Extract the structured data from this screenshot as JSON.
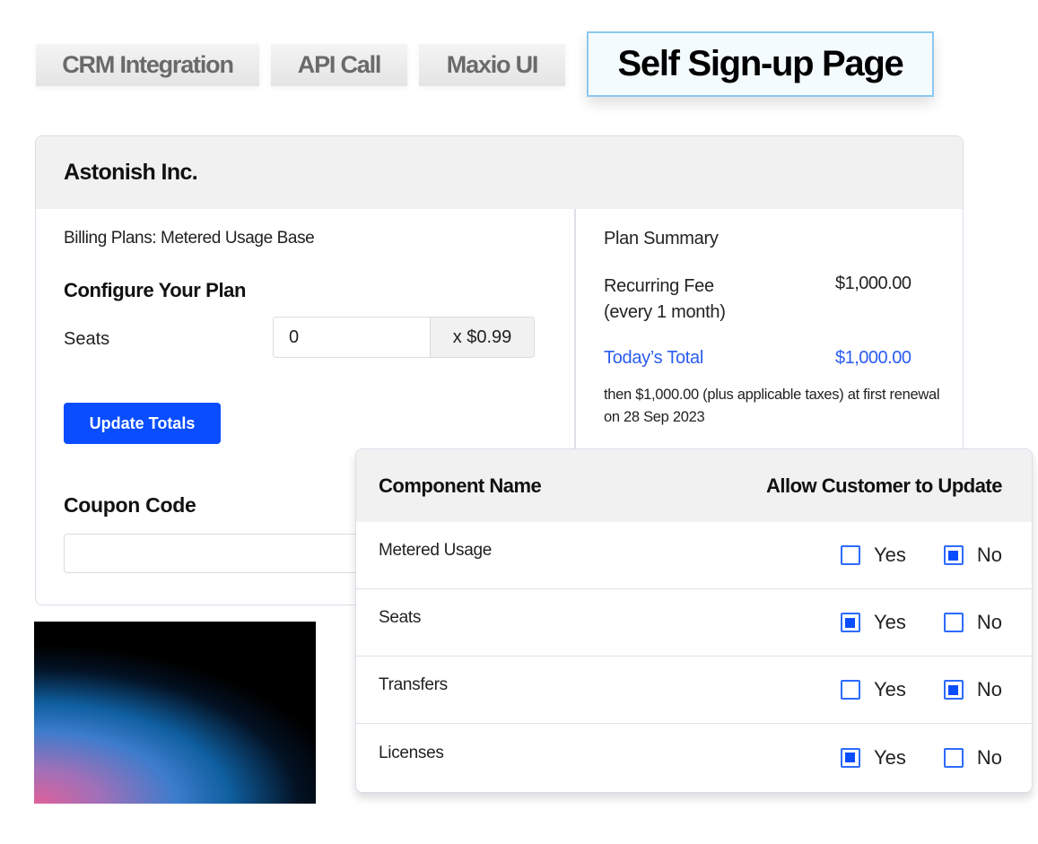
{
  "tabs": [
    {
      "label": "CRM Integration",
      "active": false
    },
    {
      "label": "API Call",
      "active": false
    },
    {
      "label": "Maxio UI",
      "active": false
    },
    {
      "label": "Self Sign-up Page",
      "active": true
    }
  ],
  "card": {
    "company": "Astonish Inc.",
    "billing_plan": "Billing Plans: Metered Usage Base",
    "configure_title": "Configure Your Plan",
    "seats": {
      "label": "Seats",
      "value": "0",
      "unit_price": "x $0.99"
    },
    "update_button": "Update Totals",
    "coupon": {
      "title": "Coupon Code",
      "value": "",
      "placeholder": ""
    },
    "summary": {
      "title": "Plan Summary",
      "recurring_fee_label": "Recurring Fee",
      "recurring_fee_period": "(every 1 month)",
      "recurring_fee_value": "$1,000.00",
      "todays_total_label": "Today’s Total",
      "todays_total_value": "$1,000.00",
      "renewal_note": "then $1,000.00 (plus applicable taxes) at first renewal on 28 Sep 2023"
    }
  },
  "components_table": {
    "headers": {
      "name": "Component Name",
      "allow": "Allow Customer to Update"
    },
    "yes_label": "Yes",
    "no_label": "No",
    "rows": [
      {
        "name": "Metered Usage",
        "yes": false,
        "no": true
      },
      {
        "name": "Seats",
        "yes": true,
        "no": false
      },
      {
        "name": "Transfers",
        "yes": false,
        "no": true
      },
      {
        "name": "Licenses",
        "yes": true,
        "no": false
      }
    ]
  },
  "colors": {
    "accent": "#0a4dff",
    "total_text": "#2a5cf0",
    "active_tab_border": "#8cc8ee"
  }
}
